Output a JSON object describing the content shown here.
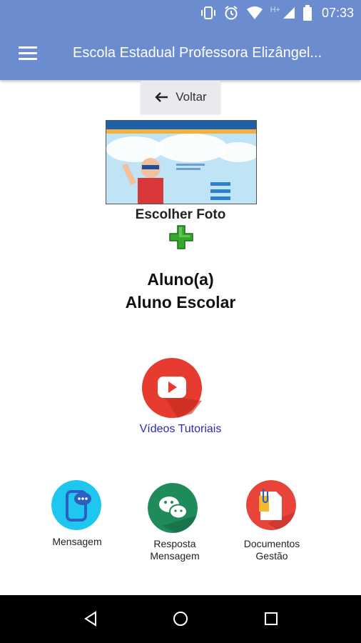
{
  "status_bar": {
    "time": "07:33",
    "network_label": "H+",
    "icons": [
      "vibrate-icon",
      "alarm-icon",
      "wifi-icon",
      "signal-icon",
      "battery-icon"
    ]
  },
  "app_bar": {
    "title": "Escola Estadual Professora Elizângel...",
    "menu_icon": "hamburger-menu-icon",
    "color": "#6b8ccf"
  },
  "back_button": {
    "label": "Voltar",
    "icon": "arrow-left-icon"
  },
  "profile": {
    "choose_photo_label": "Escolher Foto",
    "add_icon": "green-plus-icon",
    "role": "Aluno(a)",
    "name": "Aluno Escolar"
  },
  "video_tutorials": {
    "label": "Vídeos Tutoriais",
    "icon": "youtube-play-icon",
    "label_color": "#2d2ab6"
  },
  "tiles": [
    {
      "label_line1": "Mensagem",
      "label_line2": "",
      "icon": "chat-phone-icon",
      "color": "#1ec6f0"
    },
    {
      "label_line1": "Resposta",
      "label_line2": "Mensagem",
      "icon": "wechat-bubbles-icon",
      "color": "#1f8a5a"
    },
    {
      "label_line1": "Documentos",
      "label_line2": "Gestão",
      "icon": "document-clip-icon",
      "color": "#e8443a"
    }
  ],
  "nav_bar": {
    "icons": [
      "back-triangle-icon",
      "home-circle-icon",
      "recents-square-icon"
    ]
  }
}
